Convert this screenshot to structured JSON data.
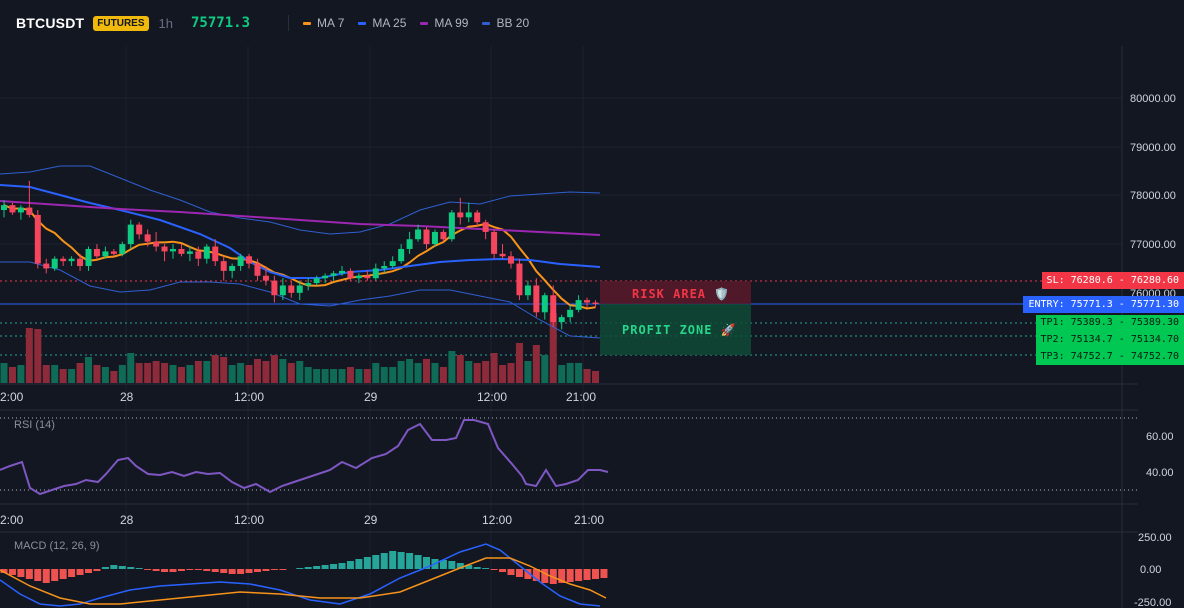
{
  "header": {
    "symbol": "BTCUSDT",
    "badge": "FUTURES",
    "timeframe": "1h",
    "last_price": "75771.3",
    "indicators": [
      {
        "label": "MA 7",
        "color": "#f7931a"
      },
      {
        "label": "MA 25",
        "color": "#2962ff"
      },
      {
        "label": "MA 99",
        "color": "#9c27b0"
      },
      {
        "label": "BB 20",
        "color": "#2f5fd0"
      }
    ]
  },
  "price_axis": [
    "80000.00",
    "79000.00",
    "78000.00",
    "77000.00",
    "76000.00"
  ],
  "time_axis": [
    "2:00",
    "28",
    "12:00",
    "29",
    "12:00",
    "21:00"
  ],
  "zones": {
    "risk_label": "RISK AREA 🛡️",
    "profit_label": "PROFIT ZONE 🚀"
  },
  "levels": {
    "sl": "SL: 76280.6 - 76280.60",
    "entry": "ENTRY: 75771.3 - 75771.30",
    "tp1": "TP1: 75389.3 - 75389.30",
    "tp2": "TP2: 75134.7 - 75134.70",
    "tp3": "TP3: 74752.7 - 74752.70"
  },
  "rsi": {
    "title": "RSI (14)",
    "axis": [
      "60.00",
      "40.00"
    ],
    "color": "#7e57c2"
  },
  "macd": {
    "title": "MACD (12, 26, 9)",
    "axis": [
      "250.00",
      "0.00",
      "-250.00"
    ]
  },
  "colors": {
    "up": "#0ecb81",
    "down": "#f6465d",
    "vol_up": "#0f6b56",
    "vol_down": "#8e2b3a",
    "bg": "#131722",
    "grid": "#1e222d"
  },
  "chart_data": {
    "type": "candlestick",
    "ylim": [
      74400,
      80500
    ],
    "candles": [
      [
        77700,
        77900,
        77550,
        77800
      ],
      [
        77800,
        77850,
        77600,
        77650
      ],
      [
        77650,
        77800,
        77500,
        77750
      ],
      [
        77750,
        78300,
        77550,
        77600
      ],
      [
        77600,
        77700,
        76500,
        76600
      ],
      [
        76600,
        76700,
        76400,
        76500
      ],
      [
        76500,
        76750,
        76450,
        76700
      ],
      [
        76700,
        76750,
        76550,
        76650
      ],
      [
        76650,
        76750,
        76550,
        76700
      ],
      [
        76700,
        76800,
        76450,
        76550
      ],
      [
        76550,
        76950,
        76450,
        76900
      ],
      [
        76900,
        77000,
        76700,
        76750
      ],
      [
        76750,
        76950,
        76700,
        76850
      ],
      [
        76850,
        76900,
        76750,
        76800
      ],
      [
        76800,
        77050,
        76750,
        77000
      ],
      [
        77000,
        77500,
        76900,
        77400
      ],
      [
        77400,
        77450,
        77100,
        77200
      ],
      [
        77200,
        77300,
        76950,
        77050
      ],
      [
        77050,
        77250,
        76850,
        76950
      ],
      [
        76950,
        77000,
        76650,
        76850
      ],
      [
        76850,
        77000,
        76700,
        76900
      ],
      [
        76900,
        77000,
        76750,
        76800
      ],
      [
        76800,
        76950,
        76650,
        76850
      ],
      [
        76850,
        76950,
        76550,
        76700
      ],
      [
        76700,
        77000,
        76600,
        76950
      ],
      [
        76950,
        77100,
        76550,
        76650
      ],
      [
        76650,
        76750,
        76250,
        76450
      ],
      [
        76450,
        76600,
        76300,
        76550
      ],
      [
        76550,
        76800,
        76450,
        76750
      ],
      [
        76750,
        76800,
        76500,
        76600
      ],
      [
        76600,
        76700,
        76250,
        76350
      ],
      [
        76350,
        76550,
        76150,
        76250
      ],
      [
        76250,
        76350,
        75800,
        75950
      ],
      [
        75950,
        76300,
        75850,
        76150
      ],
      [
        76150,
        76250,
        75900,
        76000
      ],
      [
        76000,
        76250,
        75850,
        76150
      ],
      [
        76150,
        76300,
        76050,
        76200
      ],
      [
        76200,
        76350,
        76150,
        76300
      ],
      [
        76300,
        76400,
        76200,
        76350
      ],
      [
        76350,
        76450,
        76250,
        76400
      ],
      [
        76400,
        76550,
        76350,
        76450
      ],
      [
        76450,
        76500,
        76250,
        76300
      ],
      [
        76300,
        76400,
        76200,
        76350
      ],
      [
        76350,
        76450,
        76250,
        76300
      ],
      [
        76300,
        76600,
        76250,
        76500
      ],
      [
        76500,
        76650,
        76400,
        76550
      ],
      [
        76550,
        76750,
        76500,
        76650
      ],
      [
        76650,
        77000,
        76600,
        76900
      ],
      [
        76900,
        77250,
        76800,
        77100
      ],
      [
        77100,
        77400,
        77050,
        77300
      ],
      [
        77300,
        77350,
        76900,
        77000
      ],
      [
        77000,
        77300,
        76950,
        77250
      ],
      [
        77250,
        77300,
        77050,
        77100
      ],
      [
        77100,
        77700,
        77050,
        77650
      ],
      [
        77650,
        77950,
        77400,
        77550
      ],
      [
        77550,
        77850,
        77450,
        77650
      ],
      [
        77650,
        77700,
        77350,
        77450
      ],
      [
        77450,
        77500,
        77100,
        77250
      ],
      [
        77250,
        77300,
        76700,
        76800
      ],
      [
        76800,
        77000,
        76700,
        76750
      ],
      [
        76750,
        76850,
        76500,
        76600
      ],
      [
        76600,
        76700,
        75850,
        75950
      ],
      [
        75950,
        76250,
        75850,
        76150
      ],
      [
        76150,
        76300,
        75500,
        75600
      ],
      [
        75600,
        76000,
        75450,
        75950
      ],
      [
        75950,
        76150,
        75300,
        75400
      ],
      [
        75400,
        75550,
        75250,
        75500
      ],
      [
        75500,
        75750,
        75400,
        75650
      ],
      [
        75650,
        75950,
        75600,
        75850
      ],
      [
        75850,
        75900,
        75700,
        75800
      ],
      [
        75800,
        75850,
        75700,
        75770
      ]
    ]
  }
}
